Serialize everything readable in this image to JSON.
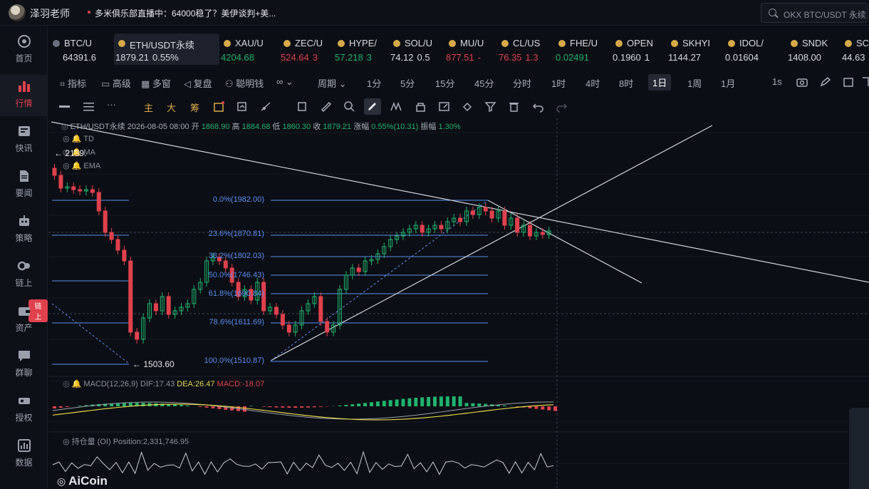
{
  "topbar": {
    "username": "泽羽老师",
    "news": "多米俱乐部直播中：64000稳了？美伊谈判+美...",
    "search_placeholder": "OKX BTC/USDT 永续"
  },
  "nav": [
    {
      "label": "首页",
      "icon": "home-icon"
    },
    {
      "label": "行情",
      "icon": "market-chart-icon",
      "active": true
    },
    {
      "label": "快讯",
      "icon": "news-icon"
    },
    {
      "label": "要闻",
      "icon": "document-icon"
    },
    {
      "label": "策略",
      "icon": "robot-icon"
    },
    {
      "label": "链上",
      "icon": "chain-icon"
    },
    {
      "label": "资产",
      "icon": "wallet-icon",
      "badge": "链上"
    },
    {
      "label": "群聊",
      "icon": "chat-icon"
    },
    {
      "label": "授权",
      "icon": "key-icon"
    },
    {
      "label": "数据",
      "icon": "data-icon"
    }
  ],
  "tickers": [
    {
      "name": "BTC/U",
      "price": "64391.6",
      "change": "",
      "trend": "neutral"
    },
    {
      "name": "ETH/USDT永续",
      "price": "1879.21",
      "change": "0.55%",
      "trend": "neutral",
      "active": true
    },
    {
      "name": "XAU/U",
      "price": "4204.68",
      "change": "",
      "trend": "up"
    },
    {
      "name": "ZEC/U",
      "price": "524.64",
      "change": "3",
      "trend": "down"
    },
    {
      "name": "HYPE/",
      "price": "57.218",
      "change": "3",
      "trend": "up"
    },
    {
      "name": "SOL/U",
      "price": "74.12",
      "change": "0.5",
      "trend": "neutral"
    },
    {
      "name": "MU/U",
      "price": "877.51",
      "change": "-",
      "trend": "down"
    },
    {
      "name": "CL/US",
      "price": "76.35",
      "change": "1.3",
      "trend": "down"
    },
    {
      "name": "FHE/U",
      "price": "0.02491",
      "change": "",
      "trend": "up"
    },
    {
      "name": "OPEN",
      "price": "0.1960",
      "change": "1",
      "trend": "neutral"
    },
    {
      "name": "SKHYI",
      "price": "1144.27",
      "change": "",
      "trend": "neutral"
    },
    {
      "name": "IDOL/",
      "price": "0.01604",
      "change": "",
      "trend": "neutral"
    },
    {
      "name": "SNDK",
      "price": "1408.00",
      "change": "",
      "trend": "neutral"
    },
    {
      "name": "SC",
      "price": "44.63",
      "change": "",
      "trend": "neutral"
    }
  ],
  "toolbar": {
    "indicators": "指标",
    "advanced": "高级",
    "multiwindow": "多窗",
    "replay": "复盘",
    "smart_money": "聪明钱",
    "period": "周期",
    "intervals": [
      "1分",
      "5分",
      "15分",
      "45分",
      "分时",
      "1时",
      "4时",
      "8时",
      "1日",
      "1周",
      "1月"
    ],
    "selected_interval": "1日",
    "refresh": "1s"
  },
  "drawing_tools": {
    "main": "主",
    "big": "大",
    "chips": "筹"
  },
  "chart": {
    "info": {
      "symbol": "ETH/USDT永续",
      "date": "2026-08-05 08:00",
      "open_label": "开",
      "open": "1868.90",
      "high_label": "高",
      "high": "1884.68",
      "low_label": "低",
      "low": "1860.30",
      "close_label": "收",
      "close": "1879.21",
      "change_label": "涨幅",
      "change": "0.55%(10.31)",
      "amp_label": "振幅",
      "amp": "1.30%"
    },
    "indicators": [
      "TD",
      "MA",
      "EMA"
    ],
    "high_marker": "2139.",
    "low_marker": "1503.60",
    "fib": [
      {
        "label": "0.0%(1982.00)"
      },
      {
        "label": "23.6%(1870.81)"
      },
      {
        "label": "38.2%(1802.03)"
      },
      {
        "label": "50.0%(1746.43)"
      },
      {
        "label": "61.8%(1690.84)"
      },
      {
        "label": "78.6%(1611.69)"
      },
      {
        "label": "100.0%(1510.87)"
      }
    ],
    "macd": {
      "name": "MACD(12,26,9)",
      "dif": "DIF:17.43",
      "dea": "DEA:26.47",
      "macd": "MACD:-18.07"
    },
    "oi": {
      "name": "持仓量 (OI)",
      "position": "Position:2,331,746.95"
    },
    "brand": "AiCoin"
  }
}
